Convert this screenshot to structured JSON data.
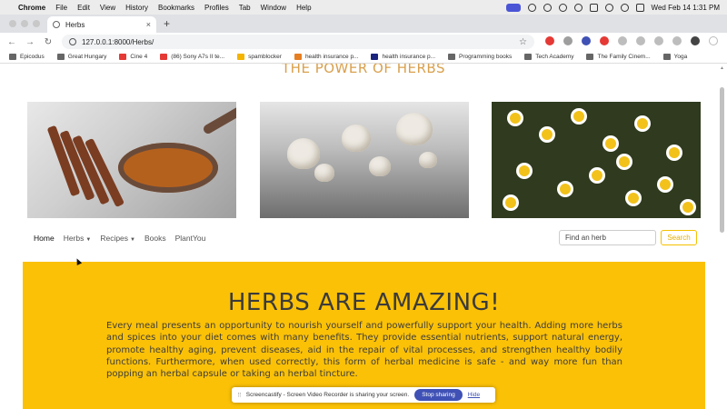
{
  "menubar": {
    "app": "Chrome",
    "items": [
      "File",
      "Edit",
      "View",
      "History",
      "Bookmarks",
      "Profiles",
      "Tab",
      "Window",
      "Help"
    ],
    "clock": "Wed Feb 14  1:31 PM"
  },
  "browser": {
    "tab_title": "Herbs",
    "url": "127.0.0.1:8000/Herbs/",
    "bookmarks": [
      {
        "label": "Epicodus",
        "color": "#666666"
      },
      {
        "label": "Great Hungary",
        "color": "#666666"
      },
      {
        "label": "Cine 4",
        "color": "#e53935"
      },
      {
        "label": "(86) Sony A7s II te...",
        "color": "#e53935"
      },
      {
        "label": "spamblocker",
        "color": "#f4b400"
      },
      {
        "label": "health insurance p...",
        "color": "#e67e22"
      },
      {
        "label": "health insurance p...",
        "color": "#1a237e"
      },
      {
        "label": "Programming books",
        "color": "#666666"
      },
      {
        "label": "Tech Academy",
        "color": "#666666"
      },
      {
        "label": "The Family Cinem...",
        "color": "#666666"
      },
      {
        "label": "Yoga",
        "color": "#666666"
      }
    ]
  },
  "page": {
    "heading": "THE POWER OF HERBS",
    "nav": {
      "home": "Home",
      "herbs": "Herbs",
      "recipes": "Recipes",
      "books": "Books",
      "plantyou": "PlantYou",
      "search_placeholder": "Find an herb",
      "search_button": "Search"
    },
    "hero": {
      "title": "HERBS ARE AMAZING!",
      "body": "Every meal presents an opportunity to nourish yourself and powerfully support your health. Adding more herbs and spices into your diet comes with many benefits. They provide essential nutrients, support natural energy, promote healthy aging, prevent diseases, aid in the repair of vital processes, and strengthen healthy bodily functions. Furthermore, when used correctly, this form of herbal medicine is safe - and way more fun than popping an herbal capsule or taking an herbal tincture."
    }
  },
  "share_banner": {
    "text": "Screencastify - Screen Video Recorder is sharing your screen.",
    "stop": "Stop sharing",
    "hide": "Hide"
  },
  "colors": {
    "accent_yellow": "#fbc107",
    "heading_gold": "#d9a04d"
  }
}
